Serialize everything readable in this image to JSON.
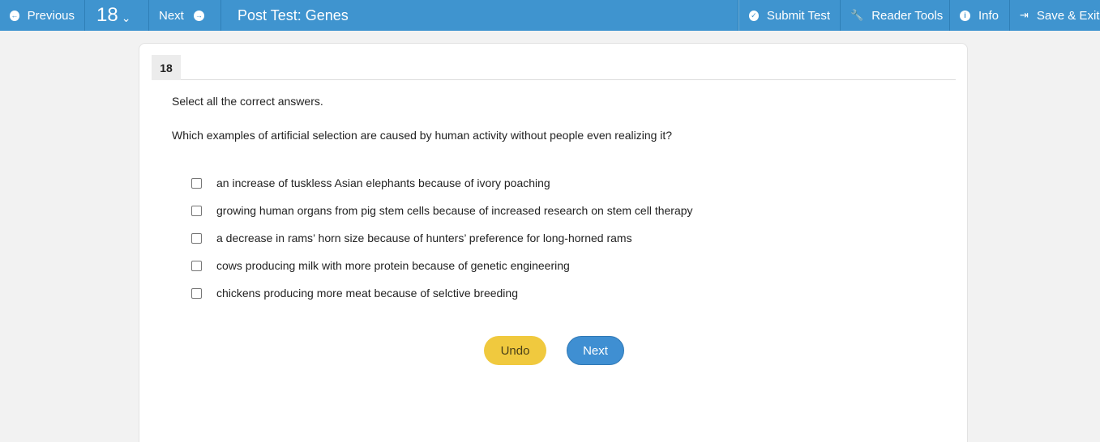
{
  "toolbar": {
    "previous_label": "Previous",
    "question_number": "18",
    "next_label": "Next",
    "test_title": "Post Test: Genes",
    "submit_label": "Submit Test",
    "reader_tools_label": "Reader Tools",
    "info_label": "Info",
    "save_exit_label": "Save & Exit"
  },
  "question": {
    "number": "18",
    "instructions": "Select all the correct answers.",
    "prompt": "Which examples of artificial selection are caused by human activity without people even realizing it?",
    "options": [
      {
        "label": "an increase of tuskless Asian elephants because of ivory poaching",
        "checked": false
      },
      {
        "label": "growing human organs from pig stem cells because of increased research on stem cell therapy",
        "checked": false
      },
      {
        "label": "a decrease in rams’ horn size because of hunters’ preference for long-horned rams",
        "checked": false
      },
      {
        "label": "cows producing milk with more protein because of genetic engineering",
        "checked": false
      },
      {
        "label": "chickens producing more meat because of selctive breeding",
        "checked": false
      }
    ]
  },
  "actions": {
    "undo_label": "Undo",
    "next_label": "Next"
  },
  "colors": {
    "toolbar": "#3f94cf",
    "undo_button": "#f0c93e",
    "next_button": "#3f8fd2"
  }
}
